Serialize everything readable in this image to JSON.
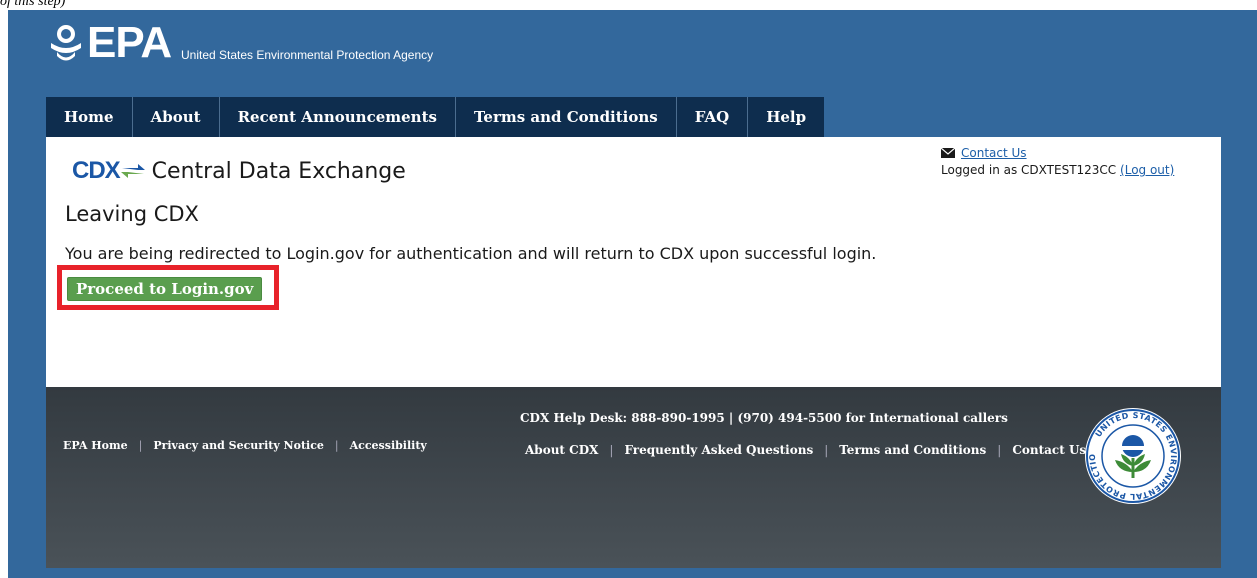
{
  "caption": "of this step)",
  "header": {
    "logo_text": "EPA",
    "agency_name": "United States Environmental Protection Agency"
  },
  "nav": {
    "items": [
      {
        "label": "Home"
      },
      {
        "label": "About"
      },
      {
        "label": "Recent Announcements"
      },
      {
        "label": "Terms and Conditions"
      },
      {
        "label": "FAQ"
      },
      {
        "label": "Help"
      }
    ]
  },
  "main": {
    "cdx_logo": "CDX",
    "site_title": "Central Data Exchange",
    "contact_label": "Contact Us",
    "logged_in_prefix": "Logged in as CDXTEST123CC",
    "logout_label": "(Log out)",
    "heading": "Leaving CDX",
    "message": "You are being redirected to Login.gov for authentication and will return to CDX upon successful login.",
    "proceed_label": "Proceed to Login.gov"
  },
  "footer": {
    "left_links": [
      "EPA Home",
      "Privacy and Security Notice",
      "Accessibility"
    ],
    "helpdesk": "CDX Help Desk: 888-890-1995 | (970) 494-5500 for International callers",
    "right_links": [
      "About CDX",
      "Frequently Asked Questions",
      "Terms and Conditions",
      "Contact Us"
    ],
    "seal_text": "UNITED STATES ENVIRONMENTAL PROTECTION AGENCY"
  },
  "colors": {
    "page_blue": "#33689c",
    "nav_dark": "#0e2d4e",
    "button_green": "#5a9e4e",
    "highlight_red": "#e8222a",
    "footer_dark": "#333a40"
  },
  "icons": {
    "mail": "envelope-icon",
    "epa_logo": "epa-flower-icon",
    "cdx_arrows": "exchange-arrows-icon",
    "seal": "epa-seal-icon"
  }
}
